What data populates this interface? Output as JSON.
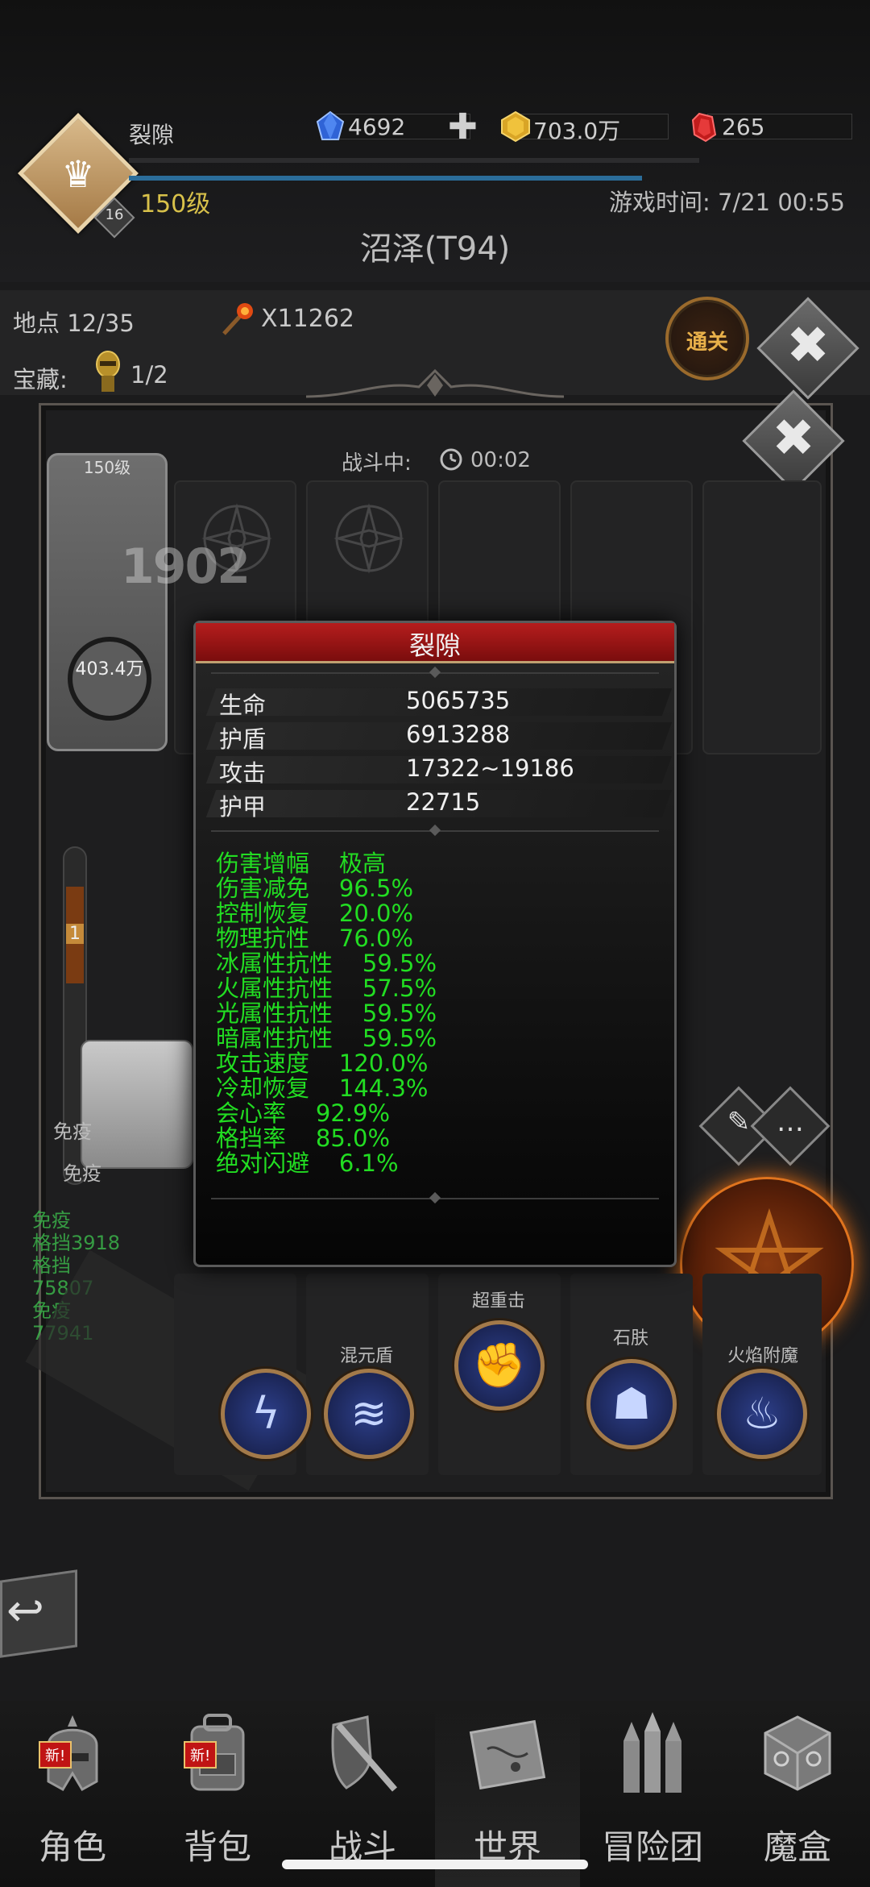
{
  "header": {
    "player_name": "裂隙",
    "player_level": "150级",
    "level_badge": "16",
    "game_time": "游戏时间: 7/21 00:55",
    "zone_title": "沼泽(T94)",
    "resources": {
      "blue_gems": "4692",
      "gold": "703.0万",
      "red_gems": "265"
    },
    "xp_fraction": 0.9
  },
  "map_info": {
    "location": "地点 12/35",
    "torch_count": "X11262",
    "treasure_label": "宝藏:",
    "treasure_count": "1/2",
    "clear_button": "通关"
  },
  "battle": {
    "status": "战斗中:",
    "timer": "00:02",
    "hero_card_level": "150级",
    "hero_hp": "403.4万",
    "floating_damage": "1902",
    "gauge_value": "1",
    "immune_text_1": "免疫",
    "immune_text_2": "免疫",
    "float_lines": [
      "免疫",
      "格挡3918",
      "格挡",
      "75807",
      "免疫",
      "77941"
    ],
    "skills": [
      {
        "label": "",
        "icon": "lightning-icon"
      },
      {
        "label": "混元盾",
        "icon": "shield-wave-icon"
      },
      {
        "label": "超重击",
        "icon": "fist-icon"
      },
      {
        "label": "石肤",
        "icon": "stone-body-icon"
      },
      {
        "label": "火焰附魔",
        "icon": "flame-icon"
      }
    ]
  },
  "popup": {
    "title": "裂隙",
    "stats": [
      {
        "name": "生命",
        "value": "5065735"
      },
      {
        "name": "护盾",
        "value": "6913288"
      },
      {
        "name": "攻击",
        "value": "17322~19186"
      },
      {
        "name": "护甲",
        "value": "22715"
      }
    ],
    "attributes": [
      "伤害增幅    极高",
      "伤害减免    96.5%",
      "控制恢复    20.0%",
      "物理抗性    76.0%",
      "冰属性抗性    59.5%",
      "火属性抗性    57.5%",
      "光属性抗性    59.5%",
      "暗属性抗性    59.5%",
      "攻击速度    120.0%",
      "冷却恢复    144.3%",
      "会心率    92.9%",
      "格挡率    85.0%",
      "绝对闪避    6.1%"
    ]
  },
  "nav": {
    "items": [
      {
        "label": "角色",
        "icon": "helmet-icon",
        "badge": "新!"
      },
      {
        "label": "背包",
        "icon": "backpack-icon",
        "badge": "新!"
      },
      {
        "label": "战斗",
        "icon": "sword-shield-icon",
        "badge": ""
      },
      {
        "label": "世界",
        "icon": "map-scroll-icon",
        "badge": ""
      },
      {
        "label": "冒险团",
        "icon": "castle-icon",
        "badge": ""
      },
      {
        "label": "魔盒",
        "icon": "magic-cube-icon",
        "badge": ""
      }
    ]
  },
  "colors": {
    "attribute_green": "#22dd22",
    "popup_header_red": "#b51d1d",
    "level_yellow": "#d8c14a",
    "fire_orange": "#e0741e"
  }
}
